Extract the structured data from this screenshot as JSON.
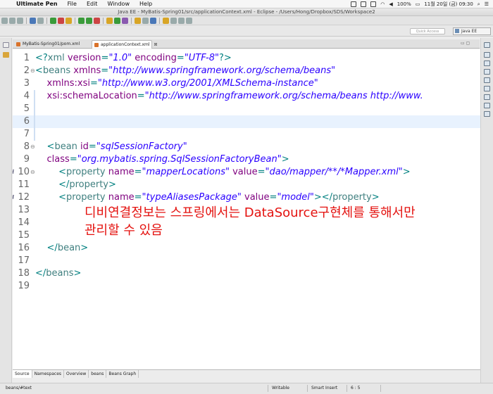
{
  "menubar": {
    "app_name": "Ultimate Pen",
    "items": [
      "File",
      "Edit",
      "Window",
      "Help"
    ],
    "status": {
      "battery": "100%",
      "datetime": "11월 20일 (금)  09:30"
    }
  },
  "window_title": "Java EE - MyBatis-Spring01/src/applicationContext.xml - Eclipse - /Users/Hong/Dropbox/SDS/Workspace2",
  "quick_access": {
    "placeholder": "Quick Access"
  },
  "perspective": "Java EE",
  "editor_tabs": [
    {
      "label": "MyBatis-Spring01/pom.xml",
      "active": false
    },
    {
      "label": "applicationContext.xml",
      "active": true,
      "close": "⊠"
    }
  ],
  "editor": {
    "lines": [
      {
        "n": "1",
        "html": "<span class=\"p\">&lt;?</span><span class=\"t\">xml</span> <span class=\"a\">version</span>=<span class=\"v\">\"1.0\"</span> <span class=\"a\">encoding</span>=<span class=\"v\">\"UTF-8\"</span><span class=\"p\">?&gt;</span>"
      },
      {
        "n": "2",
        "fold": "⊖",
        "html": "<span class=\"p\">&lt;</span><span class=\"t\">beans</span> <span class=\"a\">xmlns</span>=<span class=\"v\">\"http://www.springframework.org/schema/beans\"</span>"
      },
      {
        "n": "3",
        "html": "    <span class=\"a\">xmlns:xsi</span>=<span class=\"v\">\"http://www.w3.org/2001/XMLSchema-instance\"</span>"
      },
      {
        "n": "4",
        "html": "    <span class=\"a\">xsi:schemaLocation</span>=<span class=\"v\">\"http://www.springframework.org/schema/beans http://www.</span>"
      },
      {
        "n": "5",
        "html": ""
      },
      {
        "n": "6",
        "hl": true,
        "html": ""
      },
      {
        "n": "7",
        "html": ""
      },
      {
        "n": "8",
        "fold": "⊖",
        "html": "    <span class=\"p\">&lt;</span><span class=\"t\">bean</span> <span class=\"a\">id</span>=<span class=\"v\">\"sqlSessionFactory\"</span>"
      },
      {
        "n": "9",
        "html": "    <span class=\"a\">class</span>=<span class=\"v\">\"org.mybatis.spring.SqlSessionFactoryBean\"</span><span class=\"p\">&gt;</span>"
      },
      {
        "n": "10",
        "mark": "i",
        "fold": "⊖",
        "html": "        <span class=\"p\">&lt;</span><span class=\"t\">property</span> <span class=\"a\">name</span>=<span class=\"v\">\"mapperLocations\"</span> <span class=\"a\">value</span>=<span class=\"v\">\"dao/mapper/**/*Mapper.xml\"</span><span class=\"p\">&gt;</span>"
      },
      {
        "n": "11",
        "html": "        <span class=\"p\">&lt;/</span><span class=\"t\">property</span><span class=\"p\">&gt;</span>"
      },
      {
        "n": "12",
        "mark": "i",
        "html": "        <span class=\"p\">&lt;</span><span class=\"t\">property</span> <span class=\"a\">name</span>=<span class=\"v\">\"typeAliasesPackage\"</span> <span class=\"a\">value</span>=<span class=\"v\">\"model\"</span><span class=\"p\">&gt;&lt;/</span><span class=\"t\">property</span><span class=\"p\">&gt;</span>"
      },
      {
        "n": "13",
        "html": ""
      },
      {
        "n": "14",
        "html": ""
      },
      {
        "n": "15",
        "html": ""
      },
      {
        "n": "16",
        "html": "    <span class=\"p\">&lt;/</span><span class=\"t\">bean</span><span class=\"p\">&gt;</span>"
      },
      {
        "n": "17",
        "html": ""
      },
      {
        "n": "18",
        "html": "<span class=\"p\">&lt;/</span><span class=\"t\">beans</span><span class=\"p\">&gt;</span>"
      },
      {
        "n": "19",
        "html": ""
      }
    ],
    "annotation": [
      "디비연결정보는 스프링에서는 DataSource구현체를 통해서만",
      "관리할 수 있음"
    ]
  },
  "page_tabs": [
    {
      "label": "Source",
      "active": true
    },
    {
      "label": "Namespaces"
    },
    {
      "label": "Overview"
    },
    {
      "label": "beans"
    },
    {
      "label": "Beans Graph"
    }
  ],
  "status_bar": {
    "path": "beans/#text",
    "mode": "Writable",
    "insert": "Smart Insert",
    "position": "6 : 5"
  }
}
